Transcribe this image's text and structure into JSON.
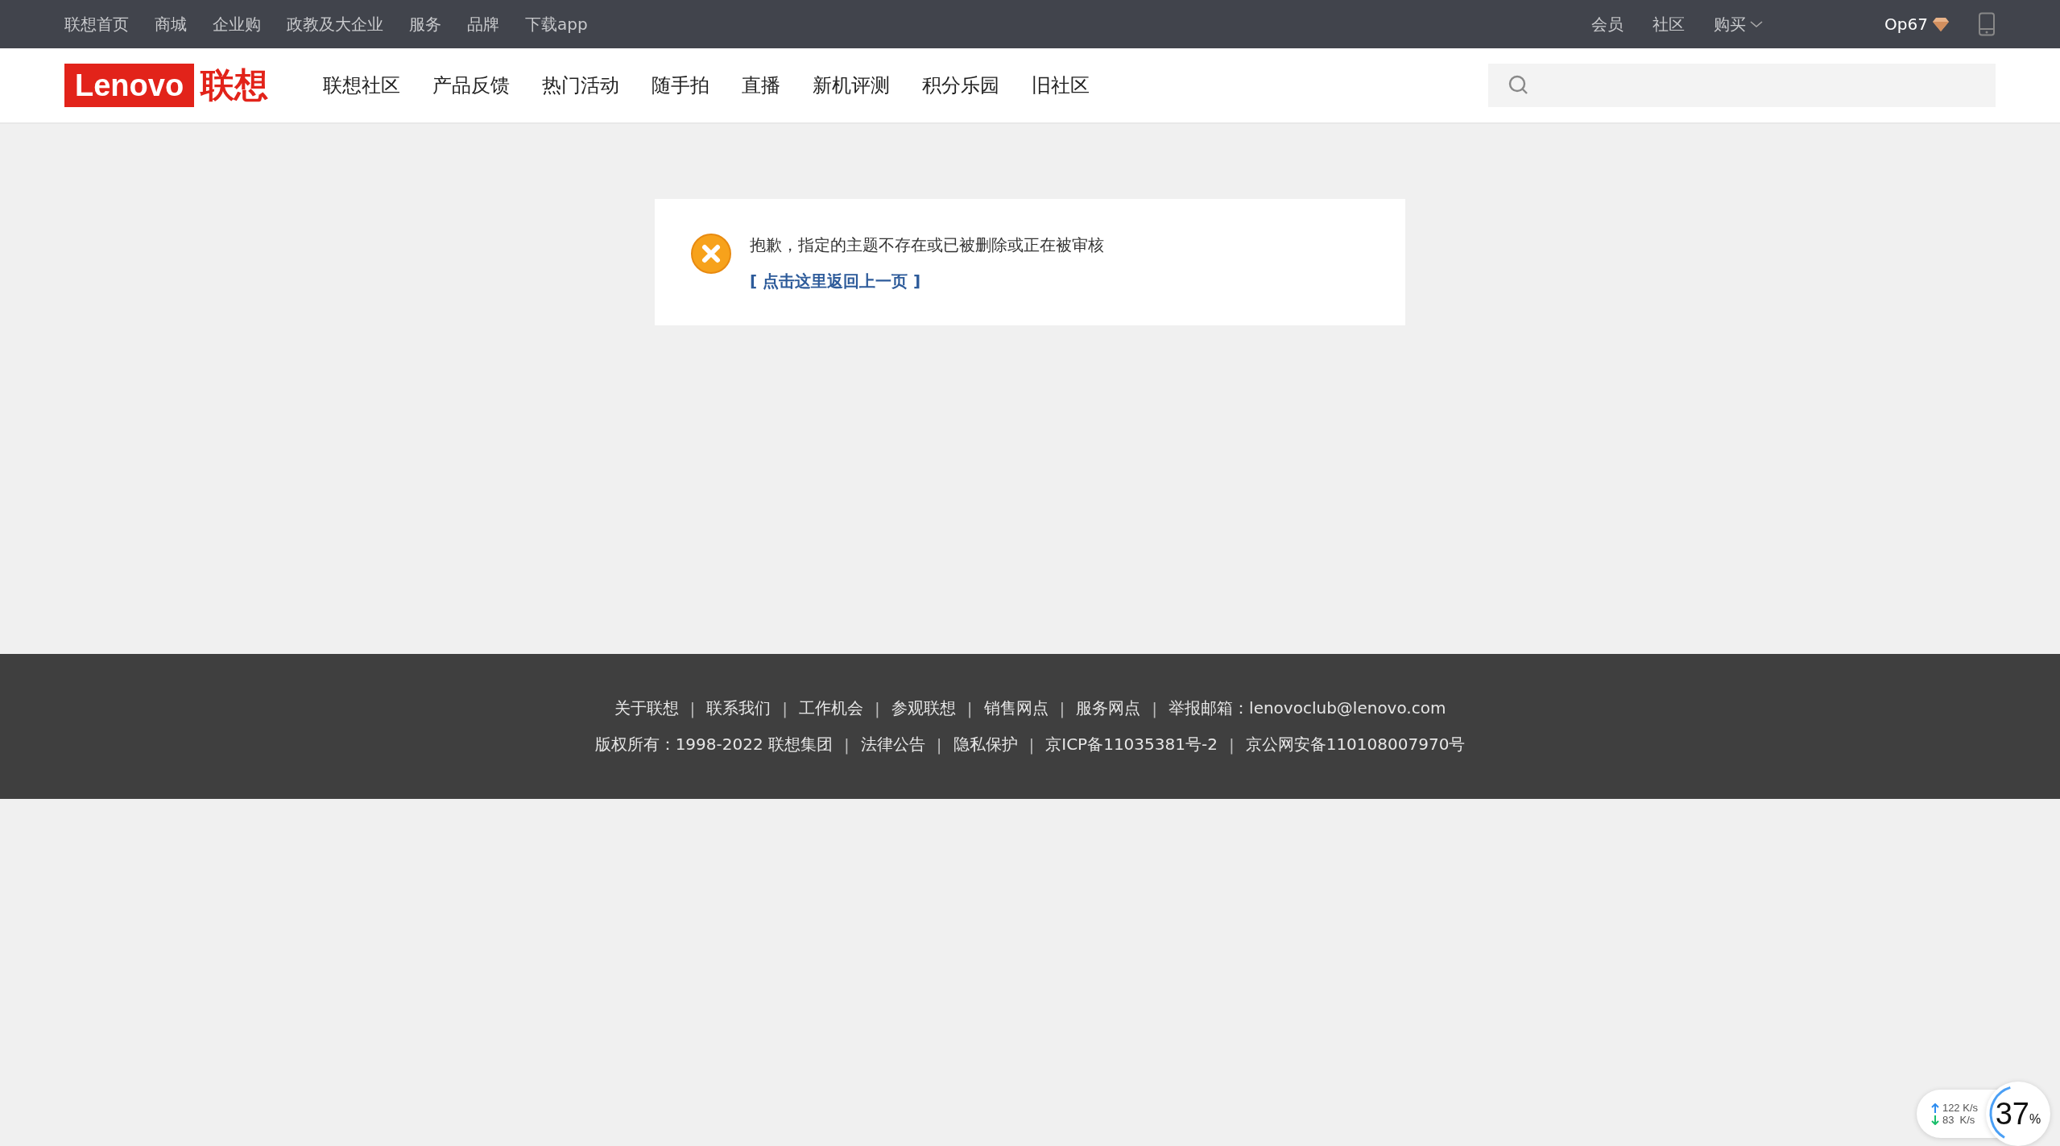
{
  "top_bar": {
    "left_links": [
      "联想首页",
      "商城",
      "企业购",
      "政教及大企业",
      "服务",
      "品牌",
      "下载app"
    ],
    "right_links": [
      {
        "label": "会员",
        "kind": "link"
      },
      {
        "label": "社区",
        "kind": "link"
      },
      {
        "label": "购买",
        "kind": "dropdown"
      }
    ],
    "user": {
      "name": "Op67"
    }
  },
  "header": {
    "logo": {
      "latin": "Lenovo",
      "chinese": "联想"
    },
    "nav": [
      "联想社区",
      "产品反馈",
      "热门活动",
      "随手拍",
      "直播",
      "新机评测",
      "积分乐园",
      "旧社区"
    ]
  },
  "message": {
    "text": "抱歉，指定的主题不存在或已被删除或正在被审核",
    "link": "[ 点击这里返回上一页 ]"
  },
  "footer": {
    "rows": [
      {
        "items": [
          {
            "kind": "link",
            "text": "关于联想"
          },
          {
            "kind": "sep",
            "text": "|"
          },
          {
            "kind": "link",
            "text": "联系我们"
          },
          {
            "kind": "sep",
            "text": "|"
          },
          {
            "kind": "link",
            "text": "工作机会"
          },
          {
            "kind": "sep",
            "text": "|"
          },
          {
            "kind": "link",
            "text": "参观联想"
          },
          {
            "kind": "sep",
            "text": "|"
          },
          {
            "kind": "link",
            "text": "销售网点"
          },
          {
            "kind": "sep",
            "text": "|"
          },
          {
            "kind": "link",
            "text": "服务网点"
          },
          {
            "kind": "sep",
            "text": "|"
          },
          {
            "kind": "link",
            "text": "举报邮箱：lenovoclub@lenovo.com"
          }
        ]
      },
      {
        "items": [
          {
            "kind": "link",
            "text": "版权所有：1998-2022 联想集团"
          },
          {
            "kind": "sep",
            "text": "|"
          },
          {
            "kind": "link",
            "text": "法律公告"
          },
          {
            "kind": "sep",
            "text": "|"
          },
          {
            "kind": "link",
            "text": "隐私保护"
          },
          {
            "kind": "sep",
            "text": "|"
          },
          {
            "kind": "link",
            "text": "京ICP备11035381号-2"
          },
          {
            "kind": "sep",
            "text": "|"
          },
          {
            "kind": "link",
            "text": "京公网安备110108007970号"
          }
        ]
      }
    ]
  },
  "speed_widget": {
    "upload": "122 K/s",
    "download": "83  K/s",
    "percent": "37",
    "unit": "%",
    "level": 0.37
  }
}
